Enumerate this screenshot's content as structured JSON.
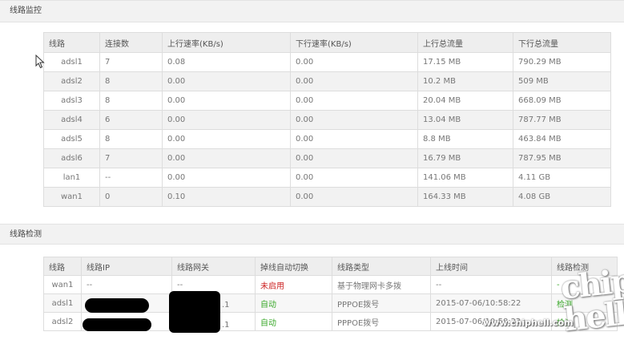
{
  "monitor": {
    "title": "线路监控",
    "headers": [
      "线路",
      "连接数",
      "上行速率(KB/s)",
      "下行速率(KB/s)",
      "上行总流量",
      "下行总流量"
    ],
    "rows": [
      [
        "adsl1",
        "7",
        "0.08",
        "0.00",
        "17.15 MB",
        "790.29 MB"
      ],
      [
        "adsl2",
        "8",
        "0.00",
        "0.00",
        "10.2 MB",
        "509 MB"
      ],
      [
        "adsl3",
        "8",
        "0.00",
        "0.00",
        "20.04 MB",
        "668.09 MB"
      ],
      [
        "adsl4",
        "6",
        "0.00",
        "0.00",
        "13.04 MB",
        "787.77 MB"
      ],
      [
        "adsl5",
        "8",
        "0.00",
        "0.00",
        "8.8 MB",
        "463.84 MB"
      ],
      [
        "adsl6",
        "7",
        "0.00",
        "0.00",
        "16.79 MB",
        "787.95 MB"
      ],
      [
        "lan1",
        "--",
        "0.00",
        "0.00",
        "141.06 MB",
        "4.11 GB"
      ],
      [
        "wan1",
        "0",
        "0.10",
        "0.00",
        "164.33 MB",
        "4.08 GB"
      ]
    ]
  },
  "detect": {
    "title": "线路检测",
    "headers": [
      "线路",
      "线路IP",
      "线路网关",
      "掉线自动切换",
      "线路类型",
      "上线时间",
      "线路检测"
    ],
    "rows": [
      [
        "wan1",
        "--",
        "--",
        "未启用",
        "基于物理网卡多拨",
        "--",
        "-"
      ],
      [
        "adsl1",
        "",
        "",
        "自动",
        "PPPOE拨号",
        "2015-07-06/10:58:22",
        "检测"
      ],
      [
        "adsl2",
        "",
        "",
        "自动",
        "PPPOE拨号",
        "2015-07-06/10:58:22",
        "检测"
      ]
    ],
    "gateway_suffix": [
      ".1",
      ".1"
    ]
  },
  "watermark": {
    "logo": "chip hell",
    "url": "www.chiphell.com"
  },
  "colors": {
    "header_bg": "#f2f2f2",
    "table_head_bg": "#eeeeee",
    "stripe": "#f2f2f2",
    "disabled": "#cc2222",
    "auto": "#3aa82a"
  }
}
